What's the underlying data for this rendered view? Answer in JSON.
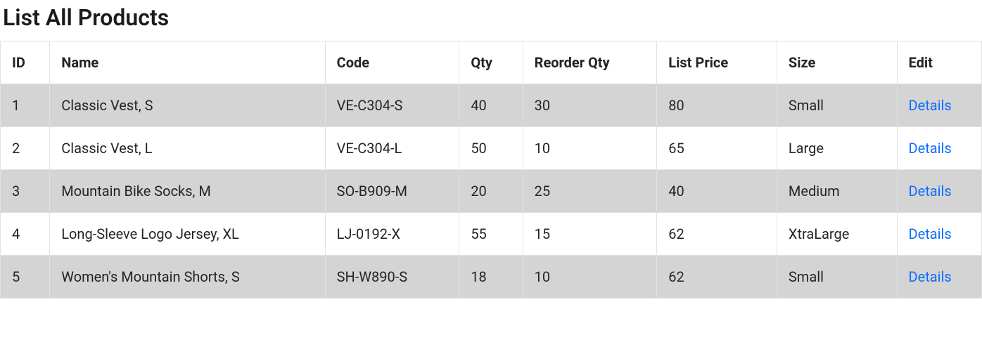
{
  "page": {
    "title": "List All Products"
  },
  "table": {
    "headers": {
      "id": "ID",
      "name": "Name",
      "code": "Code",
      "qty": "Qty",
      "reorder_qty": "Reorder Qty",
      "list_price": "List Price",
      "size": "Size",
      "edit": "Edit"
    },
    "edit_link_label": "Details",
    "rows": [
      {
        "id": "1",
        "name": "Classic Vest, S",
        "code": "VE-C304-S",
        "qty": "40",
        "reorder_qty": "30",
        "list_price": "80",
        "size": "Small"
      },
      {
        "id": "2",
        "name": "Classic Vest, L",
        "code": "VE-C304-L",
        "qty": "50",
        "reorder_qty": "10",
        "list_price": "65",
        "size": "Large"
      },
      {
        "id": "3",
        "name": "Mountain Bike Socks, M",
        "code": "SO-B909-M",
        "qty": "20",
        "reorder_qty": "25",
        "list_price": "40",
        "size": "Medium"
      },
      {
        "id": "4",
        "name": "Long-Sleeve Logo Jersey, XL",
        "code": "LJ-0192-X",
        "qty": "55",
        "reorder_qty": "15",
        "list_price": "62",
        "size": "XtraLarge"
      },
      {
        "id": "5",
        "name": "Women's Mountain Shorts, S",
        "code": "SH-W890-S",
        "qty": "18",
        "reorder_qty": "10",
        "list_price": "62",
        "size": "Small"
      }
    ]
  }
}
